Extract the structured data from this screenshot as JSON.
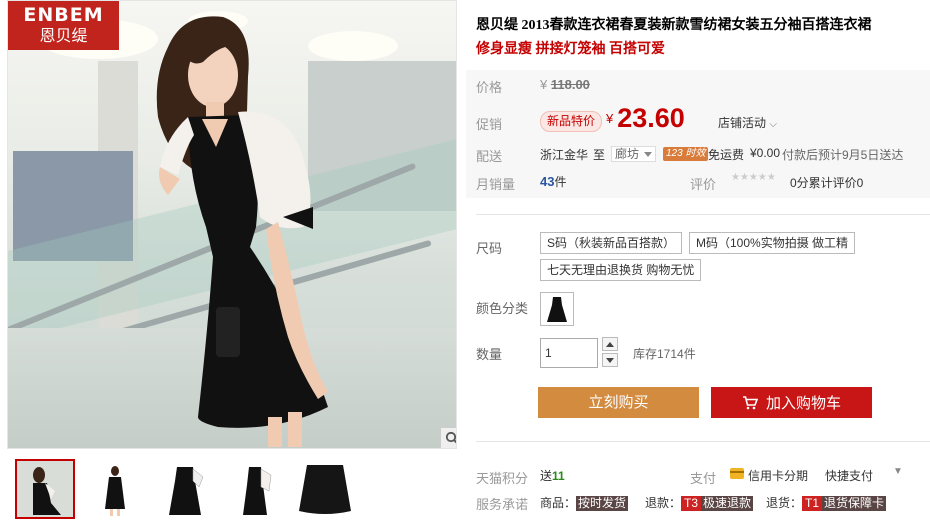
{
  "brand": {
    "logo_en": "ENBEM",
    "logo_cn": "恩贝缇"
  },
  "product": {
    "title": "恩贝缇 2013春款连衣裙春夏装新款雪纺裙女装五分袖百搭连衣裙",
    "subtitle": "修身显瘦 拼接灯笼袖 百搭可爱"
  },
  "price": {
    "label": "价格",
    "currency": "¥",
    "original": "118.00",
    "promo_label": "促销",
    "promo_tag": "新品特价",
    "promo_price": "23.60",
    "shop_event": "店铺活动"
  },
  "shipping": {
    "label": "配送",
    "from": "浙江金华",
    "to_word": "至",
    "destination": "廊坊",
    "speed_badge": "123 时效",
    "fee_label": "免运费",
    "fee": "¥0.00",
    "delivery_note": "付款后预计9月5日送达"
  },
  "sales": {
    "label": "月销量",
    "count": "43",
    "unit": "件",
    "review_label": "评价",
    "review_count": "0分累计评价0",
    "stars": "★★★★★"
  },
  "options": {
    "size_label": "尺码",
    "sizes": [
      "S码（秋装新品百搭款）",
      "M码（100%实物拍摄 做工精",
      "七天无理由退换货 购物无忧"
    ],
    "color_label": "颜色分类",
    "qty_label": "数量",
    "qty_value": "1",
    "stock": "库存1714件"
  },
  "actions": {
    "buy_now": "立刻购买",
    "add_cart": "加入购物车"
  },
  "footer": {
    "points_label": "天猫积分",
    "points_prefix": "送",
    "points_value": "11",
    "pay_label": "支付",
    "card_pay": "信用卡分期",
    "fast_pay": "快捷支付",
    "service_label": "服务承诺",
    "service_goods": "商品：",
    "service_goods_tag": "按时发货",
    "service_refund": "退款：",
    "service_refund_code": "T3",
    "service_refund_tag": "极速退款",
    "service_return": "退货：",
    "service_return_code": "T1",
    "service_return_tag": "退货保障卡"
  },
  "colors": {
    "accent": "#c40000",
    "buy_now": "#d28b3f",
    "add_cart": "#c81616"
  }
}
